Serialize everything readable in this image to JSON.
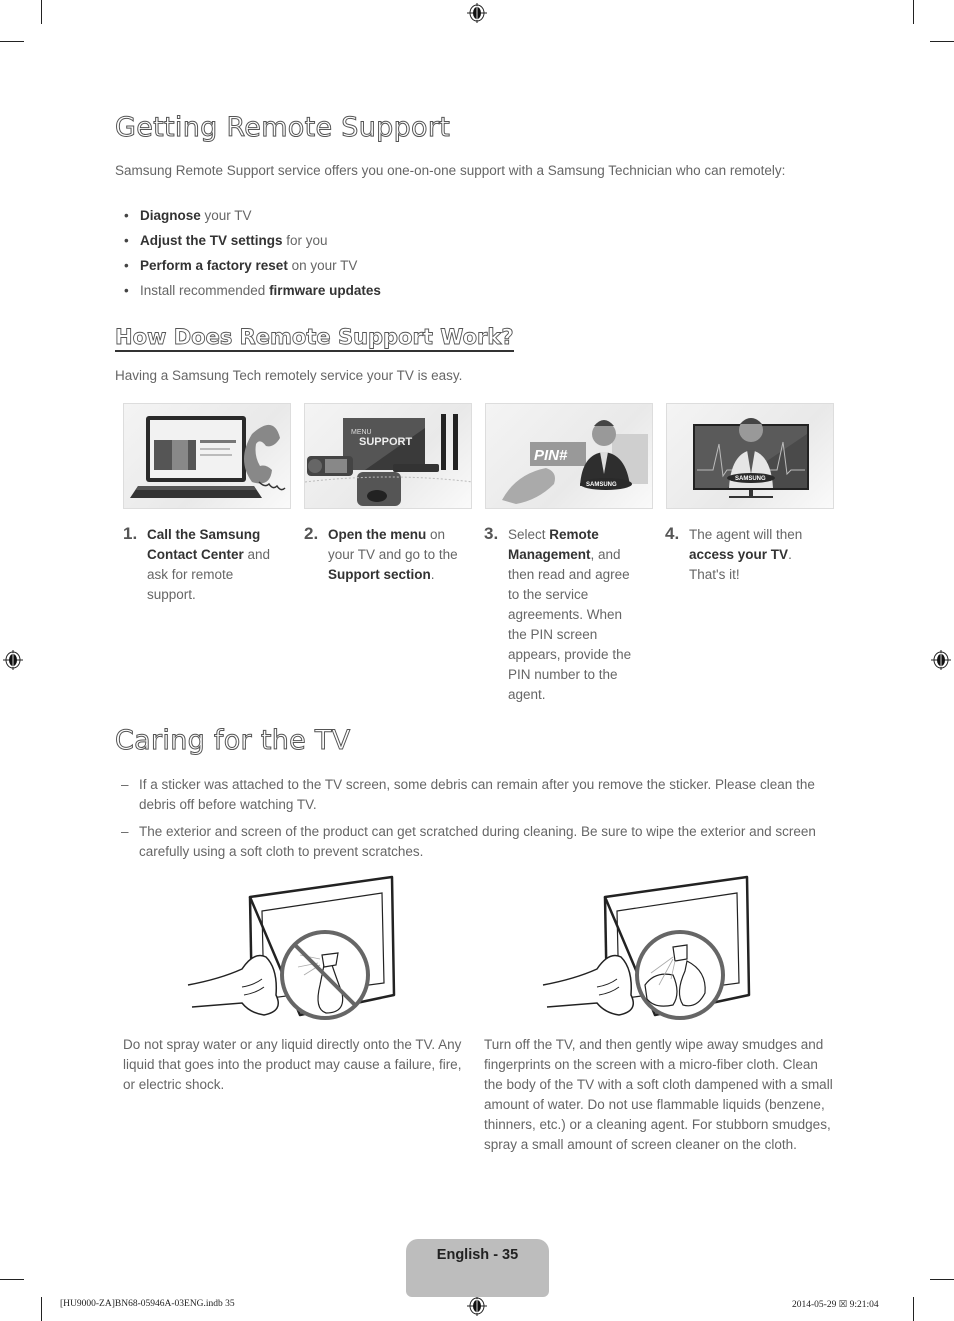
{
  "remote_support": {
    "title": "Getting Remote Support",
    "intro": "Samsung Remote Support service offers you one-on-one support with a Samsung Technician who can remotely:",
    "bullets": [
      {
        "bold": "Diagnose",
        "rest": " your TV",
        "prefix": ""
      },
      {
        "bold": "Adjust the TV settings",
        "rest": " for you",
        "prefix": ""
      },
      {
        "bold": "Perform a factory reset",
        "rest": " on your TV",
        "prefix": ""
      },
      {
        "bold": "firmware updates",
        "rest": "",
        "prefix": "Install recommended "
      }
    ],
    "bullet_glyph": "•"
  },
  "how_it_works": {
    "title": "How Does Remote Support Work?",
    "intro": "Having a Samsung Tech remotely service your TV is easy.",
    "steps": [
      {
        "num": "1.",
        "image": "laptop-phone-illustration",
        "parts": [
          {
            "b": "Call the Samsung Contact Center"
          },
          {
            "t": " and ask for remote support."
          }
        ]
      },
      {
        "num": "2.",
        "image": "tv-menu-support-illustration",
        "image_text": [
          "MENU",
          "SUPPORT"
        ],
        "parts": [
          {
            "b": "Open the menu"
          },
          {
            "t": " on your TV and go to the "
          },
          {
            "b": "Support section"
          },
          {
            "t": "."
          }
        ]
      },
      {
        "num": "3.",
        "image": "pin-agent-illustration",
        "image_text": [
          "PIN#",
          "SAMSUNG"
        ],
        "parts": [
          {
            "t": "Select "
          },
          {
            "b": "Remote Management"
          },
          {
            "t": ", and then read and agree to the service agreements. When the PIN screen appears, provide the PIN number to the agent."
          }
        ]
      },
      {
        "num": "4.",
        "image": "agent-on-tv-illustration",
        "image_text": [
          "SAMSUNG"
        ],
        "parts": [
          {
            "t": "The agent will then "
          },
          {
            "b": "access your TV"
          },
          {
            "t": ". That's it!"
          }
        ]
      }
    ]
  },
  "caring": {
    "title": "Caring for the TV",
    "dash_glyph": "–",
    "notes": [
      "If a sticker was attached to the TV screen, some debris can remain after you remove the sticker. Please clean the debris off before watching TV.",
      "The exterior and screen of the product can get scratched during cleaning. Be sure to wipe the exterior and screen carefully using a soft cloth to prevent scratches."
    ],
    "captions": [
      "Do not spray water or any liquid directly onto the TV. Any liquid that goes into the product may cause a failure, fire, or electric shock.",
      "Turn off the TV, and then gently wipe away smudges and fingerprints on the screen with a micro-fiber cloth. Clean the body of the TV with a soft cloth dampened with a small amount of water. Do not use flammable liquids (benzene, thinners, etc.) or a cleaning agent. For stubborn smudges, spray a small amount of screen cleaner on the cloth."
    ]
  },
  "footer": {
    "page_label": "English - 35",
    "slug_left": "[HU9000-ZA]BN68-05946A-03ENG.indb   35",
    "slug_right": "2014-05-29   ☒ 9:21:04"
  },
  "colors": {
    "badge": "#bdbdbd",
    "text": "#666666",
    "bold_text": "#333333"
  }
}
